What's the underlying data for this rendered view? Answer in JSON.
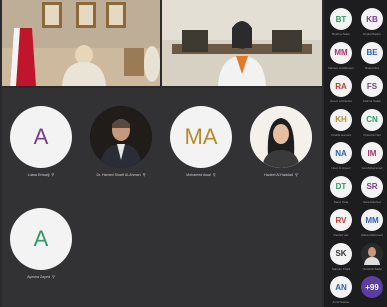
{
  "colors": {
    "page_bg": "#2b2b2e",
    "grid_bg": "#323235",
    "roster_bg": "#1d1d20",
    "avatar_bg": "#f3f3f3"
  },
  "tiles": [
    {
      "initials": "A",
      "name": "Lulwa Enwaiji",
      "color": "#7a3c8c",
      "photo": false,
      "mic_icon": "mic-off-icon"
    },
    {
      "initials": "",
      "name": "Dr. Hamed Sharif Al-Ahmari",
      "color": "#000000",
      "photo": true,
      "mic_icon": "mic-off-icon"
    },
    {
      "initials": "MA",
      "name": "Mohamed Awal",
      "color": "#b88a2e",
      "photo": false,
      "mic_icon": "mic-off-icon"
    },
    {
      "initials": "",
      "name": "Hadeel Al Haddad",
      "color": "#000000",
      "photo": true,
      "mic_icon": "mic-off-icon"
    },
    {
      "initials": "A",
      "name": "Ayesha Zayed",
      "color": "#2f9a6a",
      "photo": false,
      "mic_icon": "mic-off-icon"
    }
  ],
  "roster": [
    {
      "initials": "BT",
      "name": "Bushra Taleb",
      "color": "#2f9a6a"
    },
    {
      "initials": "KB",
      "name": "Khalid Bashir",
      "color": "#7a3c8c"
    },
    {
      "initials": "MM",
      "name": "Mariam Al Mansoor",
      "color": "#b0306a"
    },
    {
      "initials": "BE",
      "name": "Batool Eid",
      "color": "#2f5fae"
    },
    {
      "initials": "RA",
      "name": "Reem Al Rashid",
      "color": "#c0392b"
    },
    {
      "initials": "FS",
      "name": "Fatima Saleh",
      "color": "#6b4a8a"
    },
    {
      "initials": "KH",
      "name": "Khalifa Hamad",
      "color": "#b88a2e"
    },
    {
      "initials": "CN",
      "name": "Chandra Nair",
      "color": "#2f9a6a"
    },
    {
      "initials": "NA",
      "name": "Noor Al Ansari",
      "color": "#2f5fae"
    },
    {
      "initials": "IM",
      "name": "Isa Mohammed",
      "color": "#b0306a"
    },
    {
      "initials": "DT",
      "name": "Dana Tariq",
      "color": "#2f9a6a"
    },
    {
      "initials": "SR",
      "name": "Sara Rashed",
      "color": "#7a3c8c"
    },
    {
      "initials": "RV",
      "name": "Rashid Vaz",
      "color": "#c0392b"
    },
    {
      "initials": "MM",
      "name": "Maha Mahmood",
      "color": "#2f5fae"
    },
    {
      "initials": "SK",
      "name": "Salman Khalil",
      "color": "#333333"
    },
    {
      "initials": "",
      "name": "Yousif Al Sada",
      "color": "#333333"
    },
    {
      "initials": "AN",
      "name": "Amal Nasser",
      "color": "#2f5fae"
    },
    {
      "initials": "+99",
      "name": "",
      "color": "#444444"
    }
  ]
}
